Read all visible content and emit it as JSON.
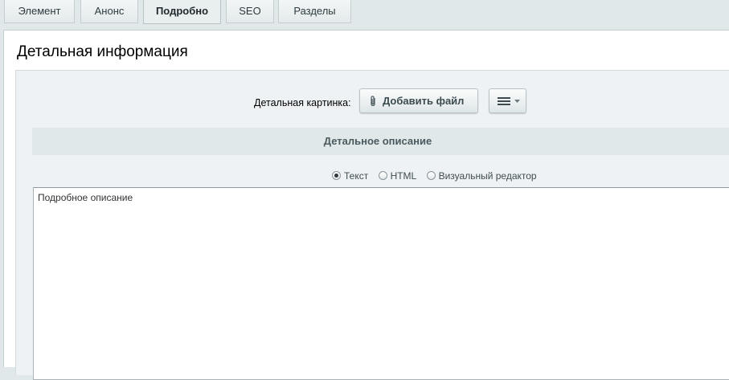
{
  "tabs": [
    {
      "label": "Элемент",
      "active": false
    },
    {
      "label": "Анонс",
      "active": false
    },
    {
      "label": "Подробно",
      "active": true
    },
    {
      "label": "SEO",
      "active": false
    },
    {
      "label": "Разделы",
      "active": false
    }
  ],
  "section": {
    "title": "Детальная информация"
  },
  "picture": {
    "label": "Детальная картинка:",
    "add_file_label": "Добавить файл"
  },
  "description": {
    "header": "Детальное описание",
    "modes": [
      {
        "label": "Текст",
        "checked": true
      },
      {
        "label": "HTML",
        "checked": false
      },
      {
        "label": "Визуальный редактор",
        "checked": false
      }
    ],
    "value": "Подробное описание"
  },
  "icons": {
    "add_file": "paperclip-icon",
    "menu": "hamburger-menu-icon",
    "menu_caret": "chevron-down-icon"
  }
}
